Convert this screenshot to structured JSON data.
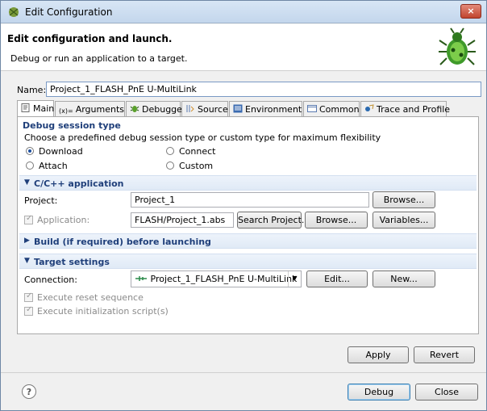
{
  "window": {
    "title": "Edit Configuration",
    "close_label": "×"
  },
  "header": {
    "title": "Edit configuration and launch.",
    "subtitle": "Debug or run an application to a target."
  },
  "name": {
    "label": "Name:",
    "value": "Project_1_FLASH_PnE U-MultiLink"
  },
  "tabs": [
    {
      "label": "Main"
    },
    {
      "label": "Arguments"
    },
    {
      "label": "Debugger"
    },
    {
      "label": "Source"
    },
    {
      "label": "Environment"
    },
    {
      "label": "Common"
    },
    {
      "label": "Trace and Profile"
    }
  ],
  "debug_session": {
    "title": "Debug session type",
    "description": "Choose a predefined debug session type or custom type for maximum flexibility",
    "options": [
      {
        "label": "Download",
        "selected": true
      },
      {
        "label": "Connect",
        "selected": false
      },
      {
        "label": "Attach",
        "selected": false
      },
      {
        "label": "Custom",
        "selected": false
      }
    ]
  },
  "cpp_app": {
    "title": "C/C++ application",
    "project_label": "Project:",
    "project_value": "Project_1",
    "browse_label": "Browse...",
    "application_label": "Application:",
    "application_value": "FLASH/Project_1.abs",
    "search_project_label": "Search Project...",
    "browse2_label": "Browse...",
    "variables_label": "Variables..."
  },
  "build": {
    "title": "Build (if required) before launching"
  },
  "target": {
    "title": "Target settings",
    "connection_label": "Connection:",
    "connection_value": "Project_1_FLASH_PnE U-MultiLink",
    "edit_label": "Edit...",
    "new_label": "New...",
    "reset_label": "Execute reset sequence",
    "init_label": "Execute initialization script(s)"
  },
  "footer": {
    "apply_label": "Apply",
    "revert_label": "Revert",
    "debug_label": "Debug",
    "close_label": "Close",
    "help_label": "?"
  },
  "colors": {
    "accent": "#1f3f7a",
    "title_bar": "#c3d6ec"
  }
}
